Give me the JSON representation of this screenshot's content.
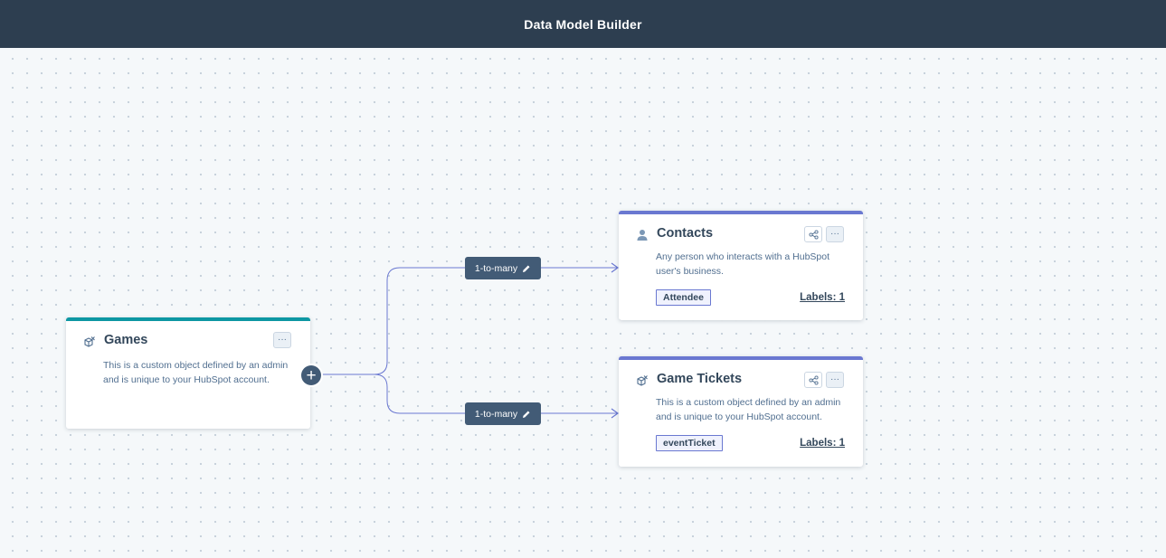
{
  "header": {
    "title": "Data Model Builder"
  },
  "nodes": {
    "games": {
      "title": "Games",
      "icon": "custom-object-icon",
      "description": "This is a custom object defined by an admin and is unique to your HubSpot account.",
      "menu_label": "···",
      "accent": "#0d97a3"
    },
    "contacts": {
      "title": "Contacts",
      "icon": "person-icon",
      "description": "Any person who interacts with a HubSpot user's business.",
      "tag": "Attendee",
      "labels": "Labels: 1",
      "menu_label": "···",
      "accent": "#6a78d1"
    },
    "tickets": {
      "title": "Game Tickets",
      "icon": "custom-object-icon",
      "description": "This is a custom object defined by an admin and is unique to your HubSpot account.",
      "tag": "eventTicket",
      "labels": "Labels: 1",
      "menu_label": "···",
      "accent": "#6a78d1"
    }
  },
  "edges": [
    {
      "from": "Games",
      "to": "Contacts",
      "label": "1-to-many",
      "icon": "pencil-icon"
    },
    {
      "from": "Games",
      "to": "Game Tickets",
      "label": "1-to-many",
      "icon": "pencil-icon"
    }
  ],
  "add_button": {
    "label": "+",
    "icon": "plus-icon"
  },
  "colors": {
    "header_bg": "#2d3e50",
    "edge_line": "#6a78d1",
    "label_bg": "#425b76",
    "canvas_bg": "#f5f8fa"
  }
}
